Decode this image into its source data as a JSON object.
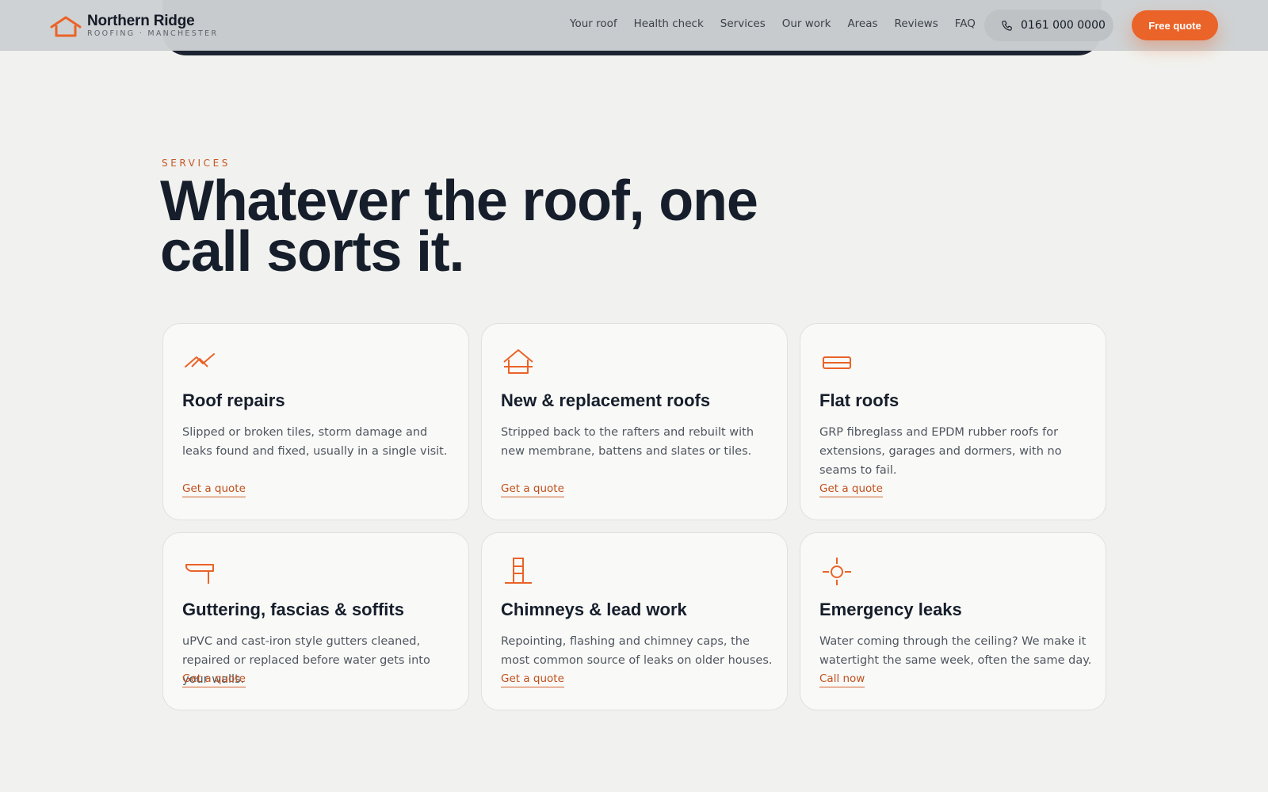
{
  "header": {
    "brand_name": "Northern Ridge",
    "brand_tagline": "ROOFING · MANCHESTER",
    "nav": [
      "Your roof",
      "Health check",
      "Services",
      "Our work",
      "Areas",
      "Reviews",
      "FAQ"
    ],
    "phone": "0161 000 0000",
    "cta": "Free quote"
  },
  "section": {
    "eyebrow": "SERVICES",
    "title_line1": "Whatever the roof, one",
    "title_line2": "call sorts it."
  },
  "services": [
    {
      "icon": "roof-repair-icon",
      "title": "Roof repairs",
      "description": "Slipped or broken tiles, storm damage and leaks found and fixed, usually in a single visit.",
      "link": "Get a quote"
    },
    {
      "icon": "house-icon",
      "title": "New & replacement roofs",
      "description": "Stripped back to the rafters and rebuilt with new membrane, battens and slates or tiles.",
      "link": "Get a quote"
    },
    {
      "icon": "flat-roof-icon",
      "title": "Flat roofs",
      "description": "GRP fibreglass and EPDM rubber roofs for extensions, garages and dormers, with no seams to fail.",
      "link": "Get a quote"
    },
    {
      "icon": "gutter-icon",
      "title": "Guttering, fascias & soffits",
      "description": "uPVC and cast-iron style gutters cleaned, repaired or replaced before water gets into your walls.",
      "link": "Get a quote"
    },
    {
      "icon": "chimney-icon",
      "title": "Chimneys & lead work",
      "description": "Repointing, flashing and chimney caps, the most common source of leaks on older houses.",
      "link": "Get a quote"
    },
    {
      "icon": "emergency-leak-icon",
      "title": "Emergency leaks",
      "description": "Water coming through the ceiling? We make it watertight the same week, often the same day.",
      "link": "Call now"
    }
  ],
  "colors": {
    "accent": "#ea6328",
    "ink": "#161e2b",
    "background": "#f1f2ef",
    "card": "#f9f9f7"
  }
}
